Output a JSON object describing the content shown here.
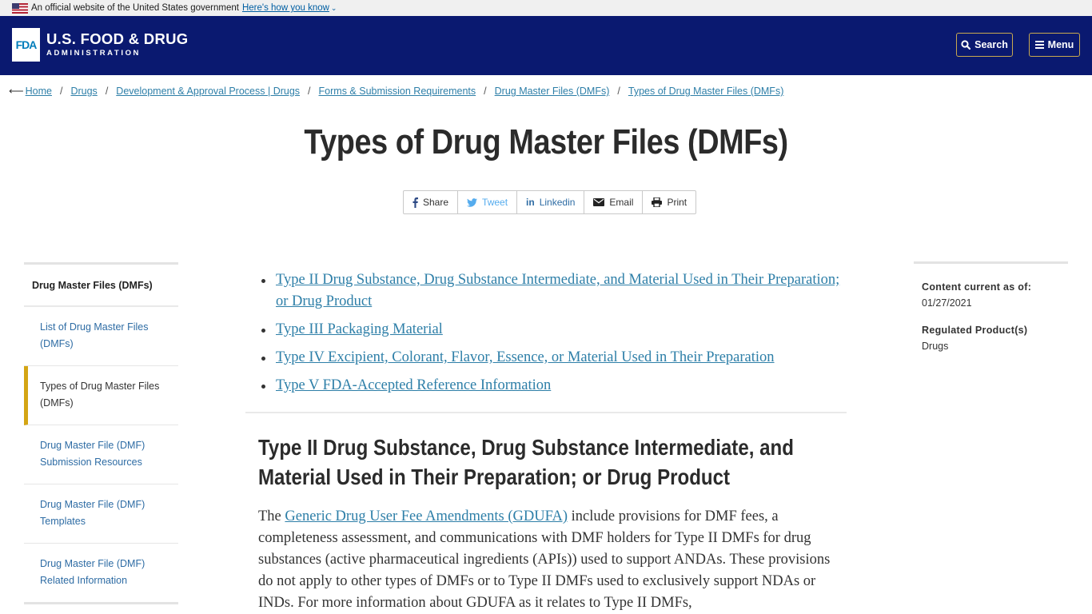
{
  "gov_banner": {
    "text": "An official website of the United States government",
    "link": "Here's how you know",
    "icons": {
      "flag": "us-flag-icon",
      "chevron": "chevron-down-icon"
    }
  },
  "header": {
    "logo_mark": "FDA",
    "logo_line1": "U.S. FOOD & DRUG",
    "logo_line2": "ADMINISTRATION",
    "search_label": "Search",
    "menu_label": "Menu",
    "colors": {
      "background": "#0a1970",
      "button_border": "#c8a850"
    }
  },
  "breadcrumb": {
    "back_icon": "arrow-left-icon",
    "items": [
      "Home",
      "Drugs",
      "Development & Approval Process | Drugs",
      "Forms & Submission Requirements",
      "Drug Master Files (DMFs)",
      "Types of Drug Master Files (DMFs)"
    ],
    "separator": "/"
  },
  "page": {
    "title": "Types of Drug Master Files (DMFs)"
  },
  "share": {
    "buttons": [
      {
        "label": "Share",
        "icon": "facebook-icon"
      },
      {
        "label": "Tweet",
        "icon": "twitter-icon"
      },
      {
        "label": "Linkedin",
        "icon": "linkedin-icon"
      },
      {
        "label": "Email",
        "icon": "envelope-icon"
      },
      {
        "label": "Print",
        "icon": "printer-icon"
      }
    ]
  },
  "left_nav": {
    "heading": "Drug Master Files (DMFs)",
    "items": [
      {
        "label": "List of Drug Master Files (DMFs)",
        "active": false
      },
      {
        "label": "Types of Drug Master Files (DMFs)",
        "active": true
      },
      {
        "label": "Drug Master File (DMF) Submission Resources",
        "active": false
      },
      {
        "label": "Drug Master File (DMF) Templates",
        "active": false
      },
      {
        "label": "Drug Master File (DMF) Related Information",
        "active": false
      }
    ],
    "active_color": "#d4a514"
  },
  "content": {
    "toc": [
      "Type II Drug Substance, Drug Substance Intermediate, and Material Used in Their Preparation; or Drug Product",
      "Type III Packaging Material",
      "Type IV Excipient, Colorant, Flavor, Essence, or Material Used in Their Preparation",
      "Type V FDA-Accepted Reference Information"
    ],
    "section_heading": "Type II Drug Substance, Drug Substance Intermediate, and Material Used in Their Preparation; or Drug Product",
    "para_prefix": "The ",
    "para_link": "Generic Drug User Fee Amendments (GDUFA)",
    "para_rest": " include provisions for DMF fees, a completeness assessment, and communications with DMF holders for Type II DMFs for drug substances (active pharmaceutical ingredients (APIs)) used to support ANDAs. These provisions do not apply to other types of DMFs or to Type II DMFs used to exclusively support NDAs or INDs. For more information about GDUFA as it relates to Type II DMFs,"
  },
  "right_meta": {
    "content_current_label": "Content current as of:",
    "content_current_value": "01/27/2021",
    "regulated_label": "Regulated Product(s)",
    "regulated_value": "Drugs"
  }
}
